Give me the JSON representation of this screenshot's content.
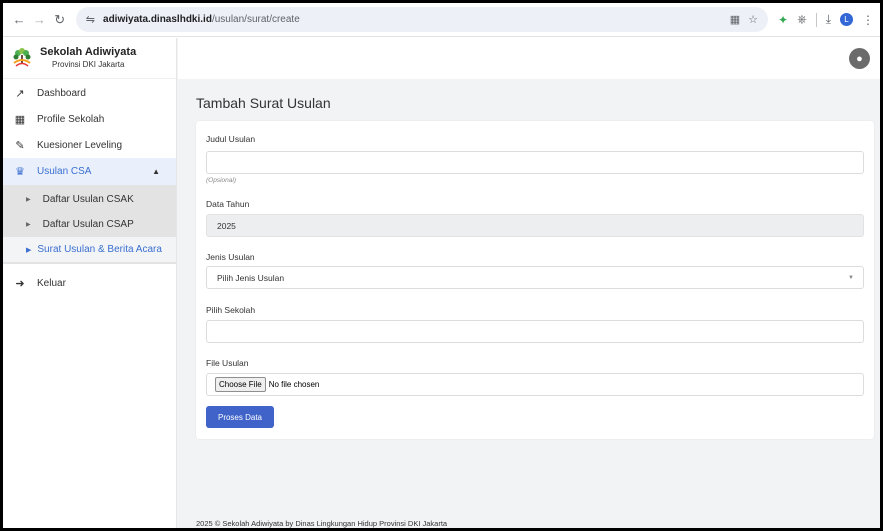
{
  "browser": {
    "url_host": "adiwiyata.dinaslhdki.id",
    "url_path": "/usulan/surat/create",
    "profile_initial": "L"
  },
  "sidebar": {
    "brand_title": "Sekolah Adiwiyata",
    "brand_subtitle": "Provinsi DKI Jakarta",
    "items": [
      {
        "label": "Dashboard",
        "icon": "chart-line-icon"
      },
      {
        "label": "Profile Sekolah",
        "icon": "building-icon"
      },
      {
        "label": "Kuesioner Leveling",
        "icon": "edit-icon"
      },
      {
        "label": "Usulan CSA",
        "icon": "trophy-icon"
      }
    ],
    "submenu": [
      {
        "label": "Daftar Usulan CSAK"
      },
      {
        "label": "Daftar Usulan CSAP"
      },
      {
        "label": "Surat Usulan & Berita Acara"
      }
    ],
    "logout_label": "Keluar"
  },
  "page": {
    "title": "Tambah Surat Usulan",
    "form": {
      "judul_label": "Judul Usulan",
      "judul_value": "",
      "judul_hint": "(Opsional)",
      "tahun_label": "Data Tahun",
      "tahun_value": "2025",
      "jenis_label": "Jenis Usulan",
      "jenis_value": "Pilih Jenis Usulan",
      "sekolah_label": "Pilih Sekolah",
      "sekolah_value": "",
      "file_label": "File Usulan",
      "choose_file_label": "Choose File",
      "no_file_label": "No file chosen",
      "submit_label": "Proses Data"
    }
  },
  "footer": {
    "text": "2025 © Sekolah Adiwiyata by Dinas Lingkungan Hidup Provinsi DKI Jakarta"
  },
  "colors": {
    "accent": "#3a6fd1",
    "button": "#3f63c8",
    "submenu_bg": "#e3e3e3"
  }
}
